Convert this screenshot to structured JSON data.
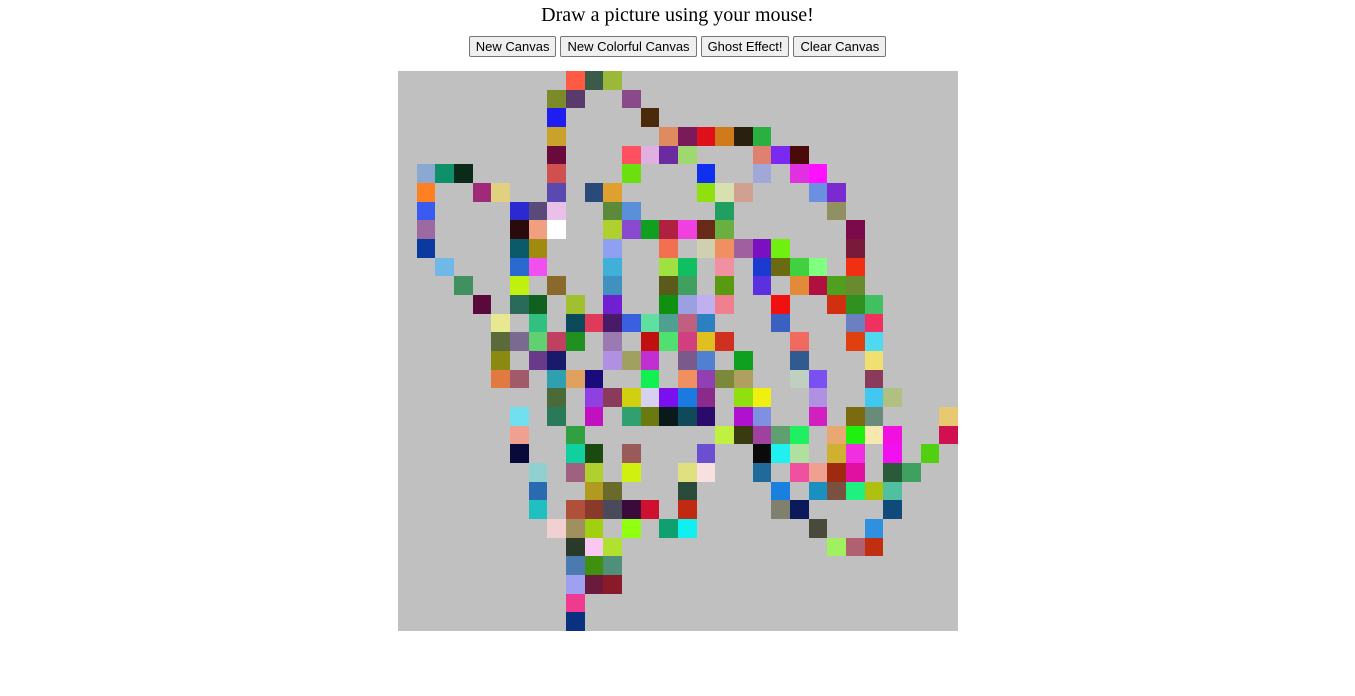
{
  "header": {
    "title": "Draw a picture using your mouse!"
  },
  "toolbar": {
    "new_canvas": "New Canvas",
    "new_colorful_canvas": "New Colorful Canvas",
    "ghost_effect": "Ghost Effect!",
    "clear_canvas": "Clear Canvas"
  },
  "canvas": {
    "columns": 30,
    "rows": 30,
    "background": "#c0c0c0",
    "colored_cells": [
      [
        0,
        9,
        "#ff5a44"
      ],
      [
        0,
        10,
        "#3a5a4a"
      ],
      [
        0,
        11,
        "#9ab83a"
      ],
      [
        1,
        8,
        "#7d8a2a"
      ],
      [
        1,
        9,
        "#5a3a6a"
      ],
      [
        1,
        12,
        "#8a4a8a"
      ],
      [
        2,
        8,
        "#1e1ef0"
      ],
      [
        2,
        13,
        "#4a2a0a"
      ],
      [
        3,
        8,
        "#c8a22a"
      ],
      [
        3,
        14,
        "#e08a60"
      ],
      [
        3,
        15,
        "#7a1a5a"
      ],
      [
        3,
        16,
        "#e0101a"
      ],
      [
        3,
        17,
        "#d07a1a"
      ],
      [
        3,
        18,
        "#2a2010"
      ],
      [
        3,
        19,
        "#2ab040"
      ],
      [
        4,
        8,
        "#6a0a3a"
      ],
      [
        4,
        12,
        "#ff5060"
      ],
      [
        4,
        13,
        "#e0b0e0"
      ],
      [
        4,
        14,
        "#6a2aa0"
      ],
      [
        4,
        15,
        "#a0d870"
      ],
      [
        4,
        19,
        "#e08070"
      ],
      [
        4,
        20,
        "#7a2af0"
      ],
      [
        4,
        21,
        "#4a0a0a"
      ],
      [
        5,
        1,
        "#8aa8d0"
      ],
      [
        5,
        2,
        "#10906a"
      ],
      [
        5,
        3,
        "#0a2a1a"
      ],
      [
        5,
        8,
        "#d05050"
      ],
      [
        5,
        12,
        "#6ae010"
      ],
      [
        5,
        16,
        "#1030f0"
      ],
      [
        5,
        19,
        "#a0a8d8"
      ],
      [
        5,
        21,
        "#e030e0"
      ],
      [
        5,
        22,
        "#ff10ff"
      ],
      [
        6,
        1,
        "#ff8020"
      ],
      [
        6,
        4,
        "#a02a7a"
      ],
      [
        6,
        5,
        "#e0d080"
      ],
      [
        6,
        8,
        "#5a4ab0"
      ],
      [
        6,
        10,
        "#2a4a7a"
      ],
      [
        6,
        11,
        "#e0a030"
      ],
      [
        6,
        16,
        "#90e010"
      ],
      [
        6,
        17,
        "#d8e0b0"
      ],
      [
        6,
        18,
        "#d0a090"
      ],
      [
        6,
        22,
        "#6a90e0"
      ],
      [
        6,
        23,
        "#7a2ad0"
      ],
      [
        7,
        1,
        "#3a5af0"
      ],
      [
        7,
        6,
        "#2a2ad0"
      ],
      [
        7,
        7,
        "#5a4a7a"
      ],
      [
        7,
        8,
        "#e8c0e8"
      ],
      [
        7,
        11,
        "#5a8a3a"
      ],
      [
        7,
        12,
        "#5a90d8"
      ],
      [
        7,
        17,
        "#20a060"
      ],
      [
        7,
        23,
        "#909060"
      ],
      [
        8,
        1,
        "#9a6aa0"
      ],
      [
        8,
        6,
        "#2a0a0a"
      ],
      [
        8,
        7,
        "#f0a080"
      ],
      [
        8,
        8,
        "#ffffff"
      ],
      [
        8,
        11,
        "#b0d030"
      ],
      [
        8,
        12,
        "#8a4ad0"
      ],
      [
        8,
        13,
        "#10a020"
      ],
      [
        8,
        14,
        "#b02040"
      ],
      [
        8,
        15,
        "#f040e0"
      ],
      [
        8,
        16,
        "#6a2a1a"
      ],
      [
        8,
        17,
        "#6ab040"
      ],
      [
        8,
        24,
        "#7a0a4a"
      ],
      [
        9,
        1,
        "#0a3aa0"
      ],
      [
        9,
        6,
        "#0a5a6a"
      ],
      [
        9,
        7,
        "#a08a10"
      ],
      [
        9,
        11,
        "#90a0f0"
      ],
      [
        9,
        14,
        "#f07050"
      ],
      [
        9,
        16,
        "#d0d0b0"
      ],
      [
        9,
        17,
        "#f09060"
      ],
      [
        9,
        18,
        "#a060a0"
      ],
      [
        9,
        19,
        "#7a10c0"
      ],
      [
        9,
        20,
        "#70f010"
      ],
      [
        9,
        24,
        "#7a1a3a"
      ],
      [
        10,
        2,
        "#70b8e8"
      ],
      [
        10,
        6,
        "#2a6ad0"
      ],
      [
        10,
        7,
        "#f050f0"
      ],
      [
        10,
        11,
        "#40b0d8"
      ],
      [
        10,
        14,
        "#a0e040"
      ],
      [
        10,
        15,
        "#10c060"
      ],
      [
        10,
        17,
        "#f090a0"
      ],
      [
        10,
        19,
        "#1a3ad0"
      ],
      [
        10,
        20,
        "#6a6a10"
      ],
      [
        10,
        21,
        "#40d040"
      ],
      [
        10,
        22,
        "#80ff80"
      ],
      [
        10,
        24,
        "#f03010"
      ],
      [
        11,
        3,
        "#409060"
      ],
      [
        11,
        6,
        "#c0f010"
      ],
      [
        11,
        8,
        "#8a6a2a"
      ],
      [
        11,
        11,
        "#4090c0"
      ],
      [
        11,
        14,
        "#5a5a1a"
      ],
      [
        11,
        15,
        "#40a060"
      ],
      [
        11,
        17,
        "#5a9a10"
      ],
      [
        11,
        19,
        "#5a30e0"
      ],
      [
        11,
        21,
        "#e08a3a"
      ],
      [
        11,
        22,
        "#b01040"
      ],
      [
        11,
        23,
        "#50a020"
      ],
      [
        11,
        24,
        "#6a8a30"
      ],
      [
        12,
        4,
        "#5a0a3a"
      ],
      [
        12,
        6,
        "#2a6a5a"
      ],
      [
        12,
        7,
        "#106020"
      ],
      [
        12,
        9,
        "#a0c030"
      ],
      [
        12,
        11,
        "#7020d0"
      ],
      [
        12,
        14,
        "#109010"
      ],
      [
        12,
        15,
        "#9aa0e0"
      ],
      [
        12,
        16,
        "#c0b0f0"
      ],
      [
        12,
        17,
        "#f08090"
      ],
      [
        12,
        20,
        "#f01010"
      ],
      [
        12,
        23,
        "#d03010"
      ],
      [
        12,
        24,
        "#309020"
      ],
      [
        12,
        25,
        "#40c060"
      ],
      [
        13,
        5,
        "#e8e890"
      ],
      [
        13,
        7,
        "#30c080"
      ],
      [
        13,
        9,
        "#0a4a5a"
      ],
      [
        13,
        10,
        "#e03a5a"
      ],
      [
        13,
        11,
        "#4a1a6a"
      ],
      [
        13,
        12,
        "#3a60e0"
      ],
      [
        13,
        13,
        "#60e0a0"
      ],
      [
        13,
        14,
        "#50a090"
      ],
      [
        13,
        15,
        "#c06080"
      ],
      [
        13,
        16,
        "#2a80c0"
      ],
      [
        13,
        20,
        "#3a60c0"
      ],
      [
        13,
        24,
        "#6a80c0"
      ],
      [
        13,
        25,
        "#f03060"
      ],
      [
        14,
        5,
        "#5a6a3a"
      ],
      [
        14,
        6,
        "#7a6a90"
      ],
      [
        14,
        7,
        "#60d070"
      ],
      [
        14,
        8,
        "#c04060"
      ],
      [
        14,
        9,
        "#209020"
      ],
      [
        14,
        11,
        "#9a7ab0"
      ],
      [
        14,
        13,
        "#c01010"
      ],
      [
        14,
        14,
        "#50e070"
      ],
      [
        14,
        15,
        "#d04080"
      ],
      [
        14,
        16,
        "#e0c020"
      ],
      [
        14,
        17,
        "#d03020"
      ],
      [
        14,
        21,
        "#f06a60"
      ],
      [
        14,
        24,
        "#e04010"
      ],
      [
        14,
        25,
        "#50d8f0"
      ],
      [
        15,
        5,
        "#8a8a10"
      ],
      [
        15,
        7,
        "#6a3a8a"
      ],
      [
        15,
        8,
        "#1a1a6a"
      ],
      [
        15,
        11,
        "#b090e0"
      ],
      [
        15,
        12,
        "#a0a060"
      ],
      [
        15,
        13,
        "#c030d0"
      ],
      [
        15,
        15,
        "#7a5a8a"
      ],
      [
        15,
        16,
        "#5080d0"
      ],
      [
        15,
        18,
        "#10a020"
      ],
      [
        15,
        21,
        "#305a90"
      ],
      [
        15,
        25,
        "#f0e070"
      ],
      [
        16,
        5,
        "#e07a40"
      ],
      [
        16,
        6,
        "#a05a6a"
      ],
      [
        16,
        8,
        "#30a0b0"
      ],
      [
        16,
        9,
        "#e0a060"
      ],
      [
        16,
        10,
        "#1a0a7a"
      ],
      [
        16,
        13,
        "#10f050"
      ],
      [
        16,
        15,
        "#f09060"
      ],
      [
        16,
        16,
        "#9040b0"
      ],
      [
        16,
        17,
        "#7a8a3a"
      ],
      [
        16,
        18,
        "#b0a060"
      ],
      [
        16,
        21,
        "#c0d0c0"
      ],
      [
        16,
        22,
        "#7a50f0"
      ],
      [
        16,
        25,
        "#8a3a5a"
      ],
      [
        17,
        8,
        "#4a6a3a"
      ],
      [
        17,
        10,
        "#9040e0"
      ],
      [
        17,
        11,
        "#8a3a5a"
      ],
      [
        17,
        12,
        "#d0d010"
      ],
      [
        17,
        13,
        "#d8d0f0"
      ],
      [
        17,
        14,
        "#7a10f0"
      ],
      [
        17,
        15,
        "#1a7ae0"
      ],
      [
        17,
        16,
        "#8a2a8a"
      ],
      [
        17,
        18,
        "#90e010"
      ],
      [
        17,
        19,
        "#f0f010"
      ],
      [
        17,
        22,
        "#b090e0"
      ],
      [
        17,
        25,
        "#40c8f0"
      ],
      [
        17,
        26,
        "#b0c080"
      ],
      [
        18,
        6,
        "#70e0f0"
      ],
      [
        18,
        8,
        "#2a7a5a"
      ],
      [
        18,
        10,
        "#c010c0"
      ],
      [
        18,
        12,
        "#30a070"
      ],
      [
        18,
        13,
        "#6a7a10"
      ],
      [
        18,
        14,
        "#0a1a1a"
      ],
      [
        18,
        15,
        "#104a5a"
      ],
      [
        18,
        16,
        "#2a0a6a"
      ],
      [
        18,
        18,
        "#b010d0"
      ],
      [
        18,
        19,
        "#8090e0"
      ],
      [
        18,
        22,
        "#d020c0"
      ],
      [
        18,
        24,
        "#7a6a10"
      ],
      [
        18,
        25,
        "#6a8a7a"
      ],
      [
        18,
        29,
        "#e8c870"
      ],
      [
        19,
        6,
        "#f0a090"
      ],
      [
        19,
        9,
        "#30a040"
      ],
      [
        19,
        17,
        "#c0f040"
      ],
      [
        19,
        18,
        "#3a3a10"
      ],
      [
        19,
        19,
        "#a040a0"
      ],
      [
        19,
        20,
        "#60a070"
      ],
      [
        19,
        21,
        "#20f060"
      ],
      [
        19,
        23,
        "#e8a870"
      ],
      [
        19,
        24,
        "#20f010"
      ],
      [
        19,
        25,
        "#f8e8b0"
      ],
      [
        19,
        26,
        "#f010e0"
      ],
      [
        19,
        29,
        "#d01050"
      ],
      [
        20,
        6,
        "#0a0a3a"
      ],
      [
        20,
        9,
        "#10d0a0"
      ],
      [
        20,
        10,
        "#1a4a10"
      ],
      [
        20,
        12,
        "#9a5a5a"
      ],
      [
        20,
        16,
        "#6a50d0"
      ],
      [
        20,
        19,
        "#0a0a0a"
      ],
      [
        20,
        20,
        "#20f0f0"
      ],
      [
        20,
        21,
        "#b0e0a0"
      ],
      [
        20,
        23,
        "#d0b030"
      ],
      [
        20,
        24,
        "#f030e0"
      ],
      [
        20,
        26,
        "#f010f0"
      ],
      [
        20,
        28,
        "#50d010"
      ],
      [
        21,
        7,
        "#90d0d0"
      ],
      [
        21,
        9,
        "#a06080"
      ],
      [
        21,
        10,
        "#b0d030"
      ],
      [
        21,
        12,
        "#d0f010"
      ],
      [
        21,
        15,
        "#e0e080"
      ],
      [
        21,
        16,
        "#f8e0e0"
      ],
      [
        21,
        19,
        "#206a9a"
      ],
      [
        21,
        21,
        "#f050a0"
      ],
      [
        21,
        22,
        "#f0a090"
      ],
      [
        21,
        23,
        "#a02a10"
      ],
      [
        21,
        24,
        "#e010a0"
      ],
      [
        21,
        26,
        "#2a5a3a"
      ],
      [
        21,
        27,
        "#40a060"
      ],
      [
        22,
        7,
        "#2a6ab0"
      ],
      [
        22,
        10,
        "#b09a20"
      ],
      [
        22,
        11,
        "#6a6a2a"
      ],
      [
        22,
        15,
        "#2a4a3a"
      ],
      [
        22,
        20,
        "#1a80e0"
      ],
      [
        22,
        22,
        "#1a90c0"
      ],
      [
        22,
        23,
        "#7a5040"
      ],
      [
        22,
        24,
        "#20f080"
      ],
      [
        22,
        25,
        "#b0c010"
      ],
      [
        22,
        26,
        "#50c0a0"
      ],
      [
        23,
        7,
        "#20c0c0"
      ],
      [
        23,
        9,
        "#b0503a"
      ],
      [
        23,
        10,
        "#8a3a2a"
      ],
      [
        23,
        11,
        "#4a4a5a"
      ],
      [
        23,
        12,
        "#3a0a3a"
      ],
      [
        23,
        13,
        "#d01030"
      ],
      [
        23,
        15,
        "#c02a10"
      ],
      [
        23,
        20,
        "#808070"
      ],
      [
        23,
        21,
        "#0a1a5a"
      ],
      [
        23,
        26,
        "#104a7a"
      ],
      [
        24,
        8,
        "#f0d0d0"
      ],
      [
        24,
        9,
        "#a09060"
      ],
      [
        24,
        10,
        "#a0d010"
      ],
      [
        24,
        12,
        "#90ff10"
      ],
      [
        24,
        14,
        "#10a070"
      ],
      [
        24,
        15,
        "#10f0f0"
      ],
      [
        24,
        22,
        "#4a4a3a"
      ],
      [
        24,
        25,
        "#3090e0"
      ],
      [
        25,
        9,
        "#2a3a2a"
      ],
      [
        25,
        10,
        "#f8c8f0"
      ],
      [
        25,
        11,
        "#b0e030"
      ],
      [
        25,
        23,
        "#a0f060"
      ],
      [
        25,
        24,
        "#b06070"
      ],
      [
        25,
        25,
        "#c03010"
      ],
      [
        26,
        9,
        "#4a7ab0"
      ],
      [
        26,
        10,
        "#409010"
      ],
      [
        26,
        11,
        "#50907a"
      ],
      [
        27,
        9,
        "#a0a0f0"
      ],
      [
        27,
        10,
        "#6a1a3a"
      ],
      [
        27,
        11,
        "#8a1a2a"
      ],
      [
        28,
        9,
        "#f03a90"
      ],
      [
        29,
        9,
        "#0a3080"
      ]
    ]
  }
}
